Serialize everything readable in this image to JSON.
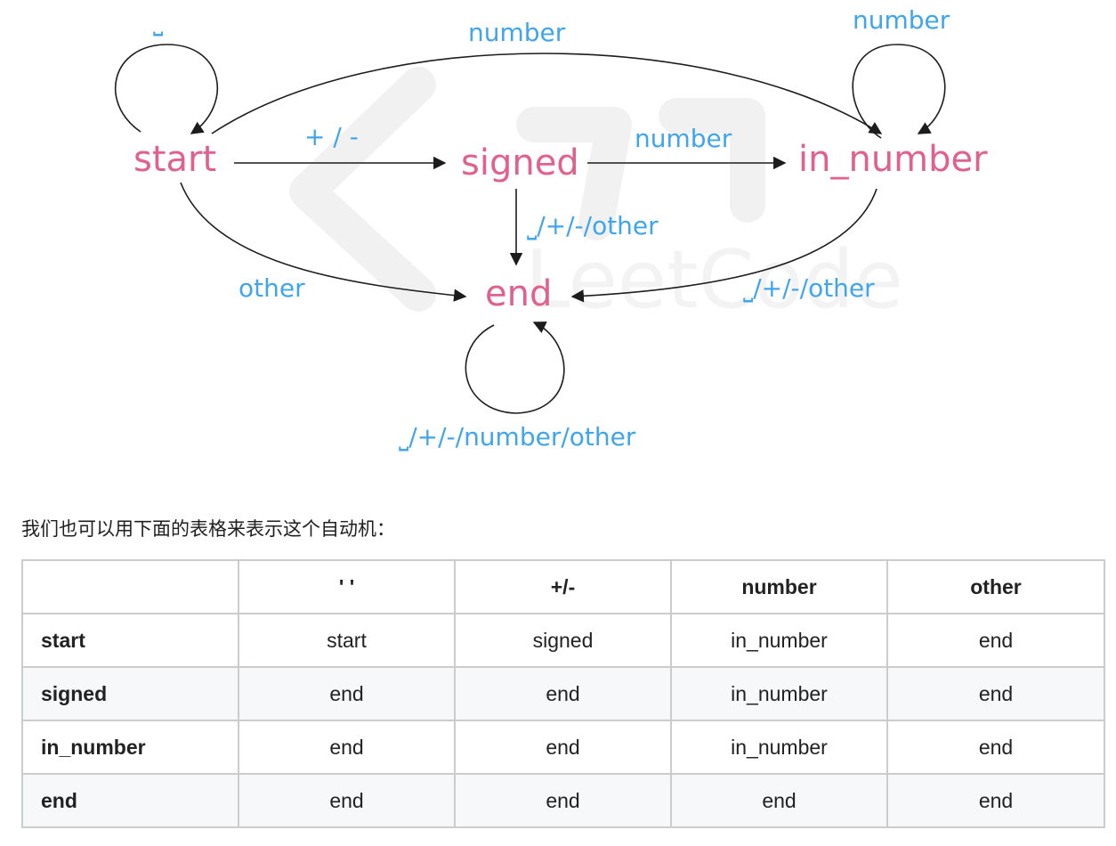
{
  "diagram": {
    "nodes": {
      "start": "start",
      "signed": "signed",
      "in_number": "in_number",
      "end": "end"
    },
    "edges": {
      "start_loop": "⎵",
      "start_to_in_number": "number",
      "in_number_loop": "number",
      "start_to_signed": "+ / -",
      "signed_to_in_number": "number",
      "signed_to_end": "⎵/+/-/other",
      "start_to_end": "other",
      "in_number_to_end": "⎵/+/-/other",
      "end_loop": "⎵/+/-/number/other"
    },
    "colors": {
      "node": "#e2608d",
      "label": "#3fa5ee",
      "edge": "#1c1c1c"
    }
  },
  "caption": "我们也可以用下面的表格来表示这个自动机：",
  "table": {
    "headers": [
      "",
      "' '",
      "+/-",
      "number",
      "other"
    ],
    "rows": [
      [
        "start",
        "start",
        "signed",
        "in_number",
        "end"
      ],
      [
        "signed",
        "end",
        "end",
        "in_number",
        "end"
      ],
      [
        "in_number",
        "end",
        "end",
        "in_number",
        "end"
      ],
      [
        "end",
        "end",
        "end",
        "end",
        "end"
      ]
    ]
  }
}
